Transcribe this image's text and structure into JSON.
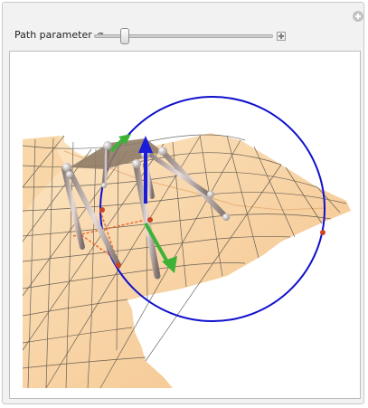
{
  "control": {
    "label": "Path parameter",
    "symbol": "α",
    "slider_value_fraction": 0.18
  },
  "icons": {
    "corner": "plus-circle-icon",
    "slider_increment": "plus-box-icon"
  },
  "colors": {
    "panel_background": "#f2f2f2",
    "surface": "#f6c98b",
    "circle": "#1010cc",
    "platform": "#8f7c68",
    "arrow_blue": "#1b1bd8",
    "arrow_green": "#3db236",
    "dashed_path": "#e86a2a"
  }
}
